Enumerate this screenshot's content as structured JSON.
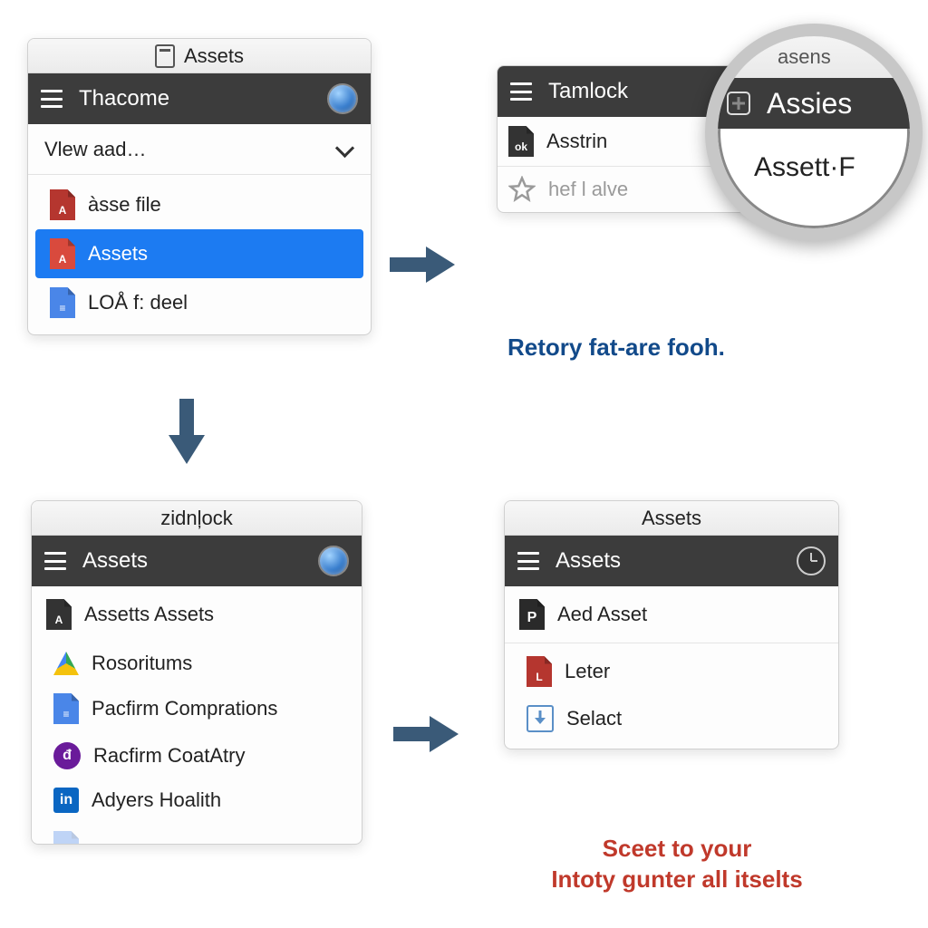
{
  "panel1": {
    "title": "Assets",
    "darkbar_title": "Thacome",
    "dropdown": "Vlew aad…",
    "items": [
      {
        "label": "àsse file",
        "icon": "red"
      },
      {
        "label": "Assets",
        "icon": "red",
        "selected": true
      },
      {
        "label": "LOÅ f: deel",
        "icon": "blue"
      }
    ]
  },
  "panel2": {
    "darkbar_title": "Tamlock",
    "items": [
      {
        "label": "Asstrin",
        "icon": "dark"
      },
      {
        "label": "hef l alve",
        "icon": "star",
        "muted": true
      }
    ]
  },
  "magnifier": {
    "topbar": "asens",
    "dark_title": "Assies",
    "content": "Assett·F"
  },
  "caption_blue": "Retory fat-are fooh.",
  "panel3": {
    "title": "zidnļock",
    "darkbar_title": "Assets",
    "section": "Assetts Assets",
    "items": [
      {
        "label": "Rosoritums",
        "icon": "drive"
      },
      {
        "label": "Pacfirm Comprations",
        "icon": "bluefile"
      },
      {
        "label": "Racfirm CoatAtry",
        "icon": "circle"
      },
      {
        "label": "Adyers Hoalith",
        "icon": "linkedin"
      }
    ]
  },
  "panel4": {
    "title": "Assets",
    "darkbar_title": "Assets",
    "section": "Aed Asset",
    "items": [
      {
        "label": "Leter",
        "icon": "red"
      },
      {
        "label": "Selact",
        "icon": "download"
      }
    ]
  },
  "caption_red_l1": "Sceet to your",
  "caption_red_l2": "Intoty gunter all itselts"
}
